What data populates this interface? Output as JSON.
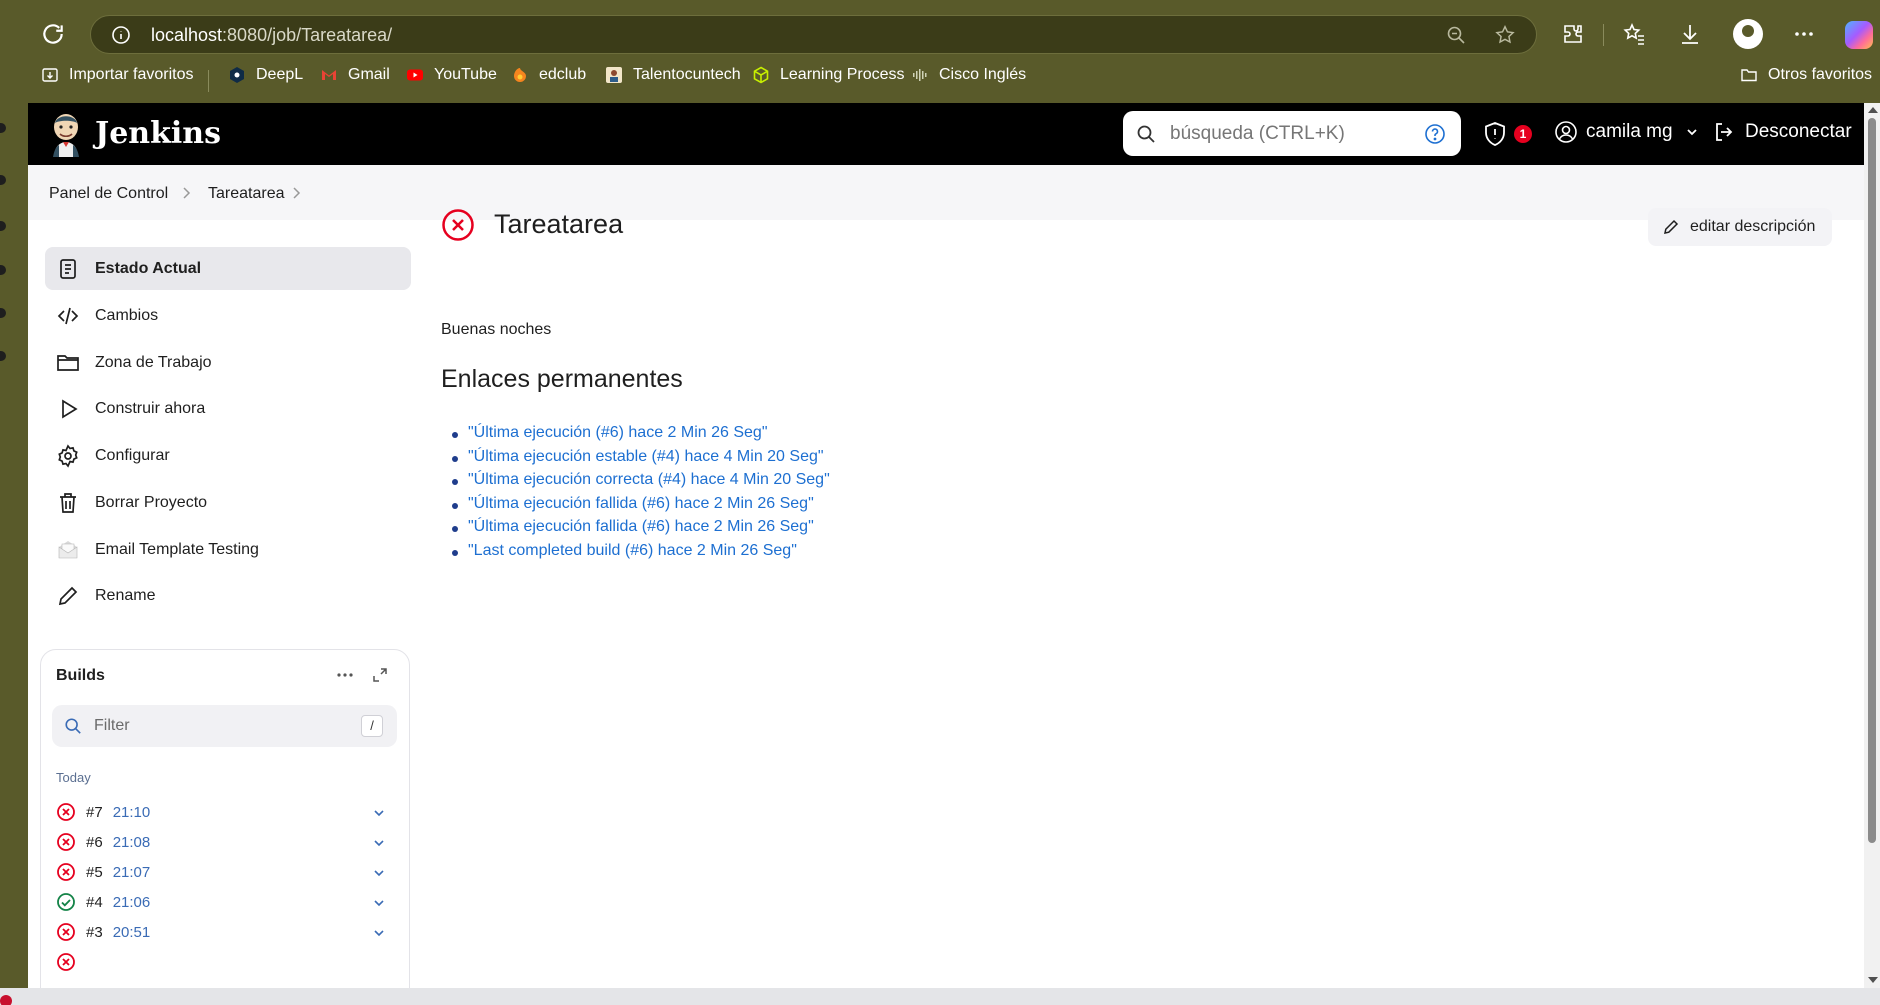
{
  "browser": {
    "url_host": "localhost",
    "url_rest": ":8080/job/Tareatarea/",
    "bookmarks": [
      {
        "label": "Importar favoritos",
        "icon": "folder-import-icon"
      },
      {
        "label": "DeepL",
        "icon": "deepl-icon"
      },
      {
        "label": "Gmail",
        "icon": "gmail-icon"
      },
      {
        "label": "YouTube",
        "icon": "youtube-icon"
      },
      {
        "label": "edclub",
        "icon": "edclub-icon"
      },
      {
        "label": "Talentocuntech",
        "icon": "talento-icon"
      },
      {
        "label": "Learning Process",
        "icon": "learning-process-icon"
      },
      {
        "label": "Cisco Inglés",
        "icon": "cisco-icon"
      }
    ],
    "other_favorites": "Otros favoritos"
  },
  "header": {
    "title": "Jenkins",
    "search_placeholder": "búsqueda (CTRL+K)",
    "alert_count": "1",
    "user": "camila mg",
    "logout": "Desconectar"
  },
  "breadcrumb": [
    "Panel de Control",
    "Tareatarea"
  ],
  "sidebar": {
    "items": [
      {
        "label": "Estado Actual",
        "icon": "status-icon",
        "active": true
      },
      {
        "label": "Cambios",
        "icon": "code-icon"
      },
      {
        "label": "Zona de Trabajo",
        "icon": "folder-icon"
      },
      {
        "label": "Construir ahora",
        "icon": "play-icon"
      },
      {
        "label": "Configurar",
        "icon": "gear-icon"
      },
      {
        "label": "Borrar Proyecto",
        "icon": "trash-icon"
      },
      {
        "label": "Email Template Testing",
        "icon": "envelope-icon"
      },
      {
        "label": "Rename",
        "icon": "pencil-icon"
      }
    ]
  },
  "builds": {
    "title": "Builds",
    "filter_placeholder": "Filter",
    "filter_key": "/",
    "group_label": "Today",
    "rows": [
      {
        "number": "#7",
        "time": "21:10",
        "status": "failed"
      },
      {
        "number": "#6",
        "time": "21:08",
        "status": "failed"
      },
      {
        "number": "#5",
        "time": "21:07",
        "status": "failed"
      },
      {
        "number": "#4",
        "time": "21:06",
        "status": "success"
      },
      {
        "number": "#3",
        "time": "20:51",
        "status": "failed"
      }
    ]
  },
  "main": {
    "job_title": "Tareatarea",
    "edit_description": "editar descripción",
    "description": "Buenas noches",
    "permalinks_title": "Enlaces permanentes",
    "permalinks": [
      "\"Última ejecución (#6) hace 2 Min 26 Seg\"",
      "\"Última ejecución estable (#4) hace 4 Min 20 Seg\"",
      "\"Última ejecución correcta (#4) hace 4 Min 20 Seg\"",
      "\"Última ejecución fallida (#6) hace 2 Min 26 Seg\"",
      "\"Última ejecución fallida (#6) hace 2 Min 26 Seg\"",
      "\"Last completed build (#6) hace 2 Min 26 Seg\""
    ]
  },
  "colors": {
    "chrome": "#595a2a",
    "failed": "#e6001f",
    "success": "#138347",
    "link": "#1d6fd1"
  }
}
